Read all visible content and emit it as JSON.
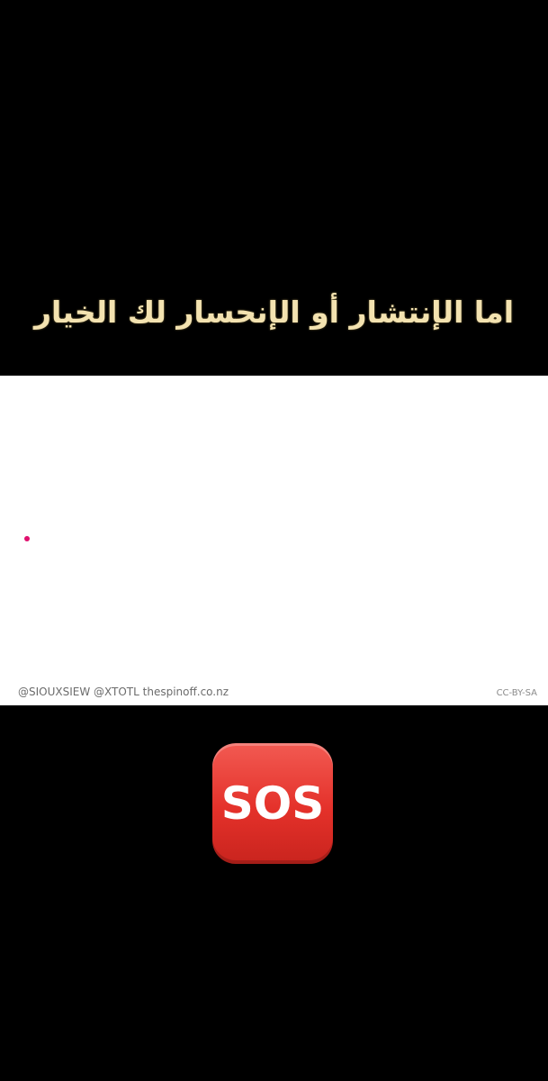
{
  "caption": {
    "text": "اما الإنتشار أو الإنحسار لك الخيار",
    "color": "#f3e2b0"
  },
  "infographic": {
    "dot_color": "#e0106e",
    "credit_left": "@SIOUXSIEW @XTOTL thespinoff.co.nz",
    "credit_right": "CC-BY-SA"
  },
  "emoji": {
    "icon": "sos-button-icon",
    "label": "SOS",
    "color": "#e4312a"
  }
}
